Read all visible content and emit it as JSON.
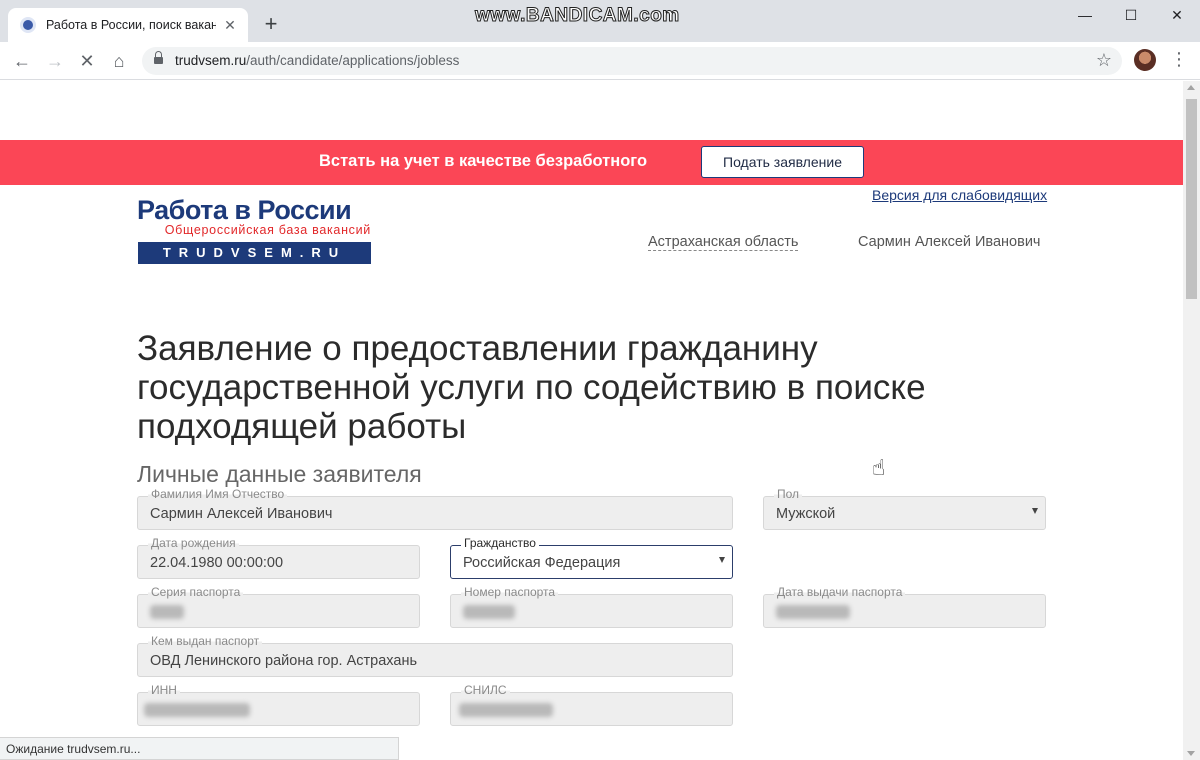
{
  "browser": {
    "tab_title": "Работа в России, поиск вакансий",
    "watermark": "www.BANDICAM.com",
    "url_host": "trudvsem.ru",
    "url_path": "/auth/candidate/applications/jobless",
    "status_text": "Ожидание trudvsem.ru..."
  },
  "banner": {
    "text": "Встать на учет в качестве безработного",
    "button_label": "Подать заявление",
    "color": "#fb4656"
  },
  "header": {
    "logo_title": "Работа в России",
    "logo_subtitle": "Общероссийская база вакансий",
    "logo_domain": "TRUDVSEM.RU",
    "accessibility_link": "Версия для слабовидящих",
    "region": "Астраханская область",
    "user_name": "Сармин Алексей Иванович"
  },
  "page": {
    "title": "Заявление о предоставлении гражданину государственной услуги по содействию в поиске подходящей работы",
    "section_title": "Личные данные заявителя"
  },
  "form": {
    "full_name": {
      "label": "Фамилия Имя Отчество",
      "value": "Сармин Алексей Иванович"
    },
    "gender": {
      "label": "Пол",
      "value": "Мужской"
    },
    "birth_date": {
      "label": "Дата рождения",
      "value": "22.04.1980 00:00:00"
    },
    "citizenship": {
      "label": "Гражданство",
      "value": "Российская Федерация"
    },
    "passport_series": {
      "label": "Серия паспорта"
    },
    "passport_number": {
      "label": "Номер паспорта"
    },
    "passport_issue_date": {
      "label": "Дата выдачи паспорта"
    },
    "passport_issuer": {
      "label": "Кем выдан паспорт",
      "value": "ОВД Ленинского района гор. Астрахань"
    },
    "inn": {
      "label": "ИНН"
    },
    "snils": {
      "label": "СНИЛС"
    }
  },
  "colors": {
    "brand_blue": "#1d3a7a",
    "brand_red": "#e2282a"
  }
}
